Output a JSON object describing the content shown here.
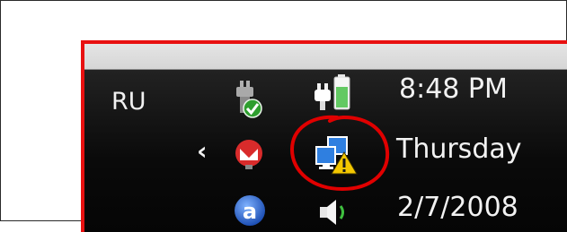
{
  "taskbar": {
    "language": "RU",
    "clock": {
      "time": "8:48 PM",
      "day": "Thursday",
      "date": "2/7/2008"
    }
  },
  "tray_icons": [
    {
      "name": "safely-remove-hardware-icon",
      "badge": "checkmark"
    },
    {
      "name": "power-plug-battery-icon"
    },
    {
      "name": "show-hidden-icons-chevron"
    },
    {
      "name": "gmail-notifier-icon"
    },
    {
      "name": "network-warning-icon",
      "badge": "warning"
    },
    {
      "name": "blue-a-circle-icon"
    },
    {
      "name": "volume-speaker-icon"
    }
  ],
  "colors": {
    "highlight_border": "#e81010",
    "annotation_circle": "#e00000",
    "tray_background": "#0b0b0b",
    "tray_text": "#f2f2f2",
    "warning_yellow": "#f3c700",
    "check_green": "#2e9e2e",
    "gmail_red": "#d92b2b"
  }
}
